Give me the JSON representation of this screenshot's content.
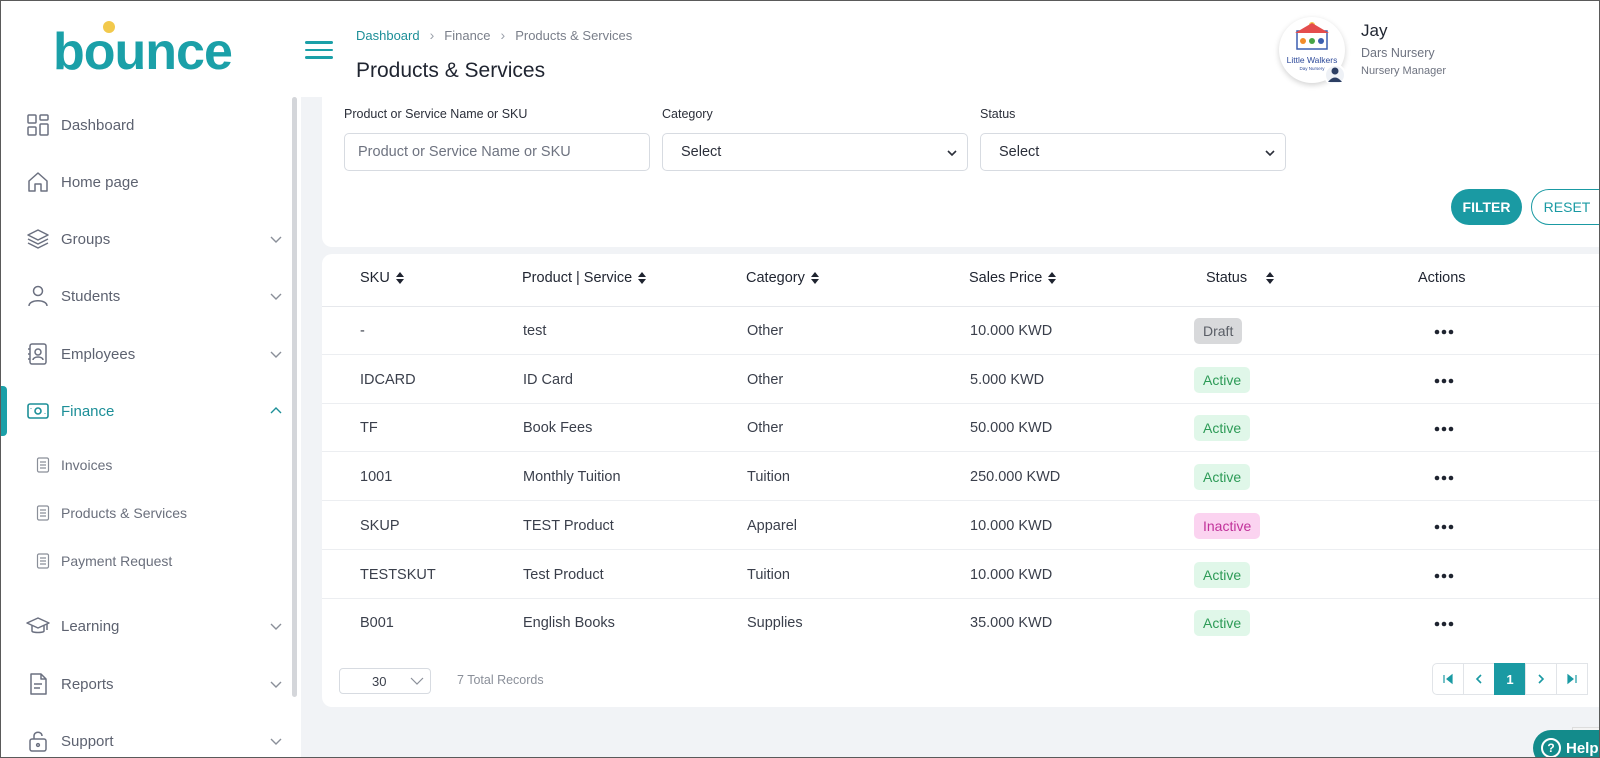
{
  "brand": {
    "logo_text": "bounce",
    "accent": "#1a9aa3"
  },
  "breadcrumb": [
    {
      "label": "Dashboard",
      "link": true
    },
    {
      "label": "Finance",
      "link": false
    },
    {
      "label": "Products & Services",
      "link": false
    }
  ],
  "page_title": "Products & Services",
  "user": {
    "name": "Jay",
    "org": "Dars Nursery",
    "role": "Nursery Manager",
    "avatar_logo_text": "Little Walkers",
    "avatar_logo_sub": "Day Nursery"
  },
  "sidebar": {
    "items": [
      {
        "label": "Dashboard",
        "icon": "dashboard-icon",
        "expandable": false
      },
      {
        "label": "Home page",
        "icon": "home-icon",
        "expandable": false
      },
      {
        "label": "Groups",
        "icon": "layers-icon",
        "expandable": true
      },
      {
        "label": "Students",
        "icon": "user-icon",
        "expandable": true
      },
      {
        "label": "Employees",
        "icon": "id-card-icon",
        "expandable": true
      },
      {
        "label": "Finance",
        "icon": "money-icon",
        "expandable": true,
        "active": true
      },
      {
        "label": "Learning",
        "icon": "graduation-cap-icon",
        "expandable": true
      },
      {
        "label": "Reports",
        "icon": "report-icon",
        "expandable": true
      },
      {
        "label": "Support",
        "icon": "lock-icon",
        "expandable": true
      }
    ],
    "finance_sub": [
      {
        "label": "Invoices",
        "icon": "document-icon"
      },
      {
        "label": "Products & Services",
        "icon": "document-icon"
      },
      {
        "label": "Payment Request",
        "icon": "document-icon"
      }
    ]
  },
  "filters": {
    "name_label": "Product or Service Name or SKU",
    "name_placeholder": "Product or Service Name or SKU",
    "category_label": "Category",
    "category_value": "Select",
    "status_label": "Status",
    "status_value": "Select",
    "filter_button": "FILTER",
    "reset_button": "RESET"
  },
  "table": {
    "columns": [
      "SKU",
      "Product | Service",
      "Category",
      "Sales Price",
      "Status",
      "Actions"
    ],
    "rows": [
      {
        "sku": "-",
        "product": "test",
        "category": "Other",
        "price": "10.000 KWD",
        "status": "Draft"
      },
      {
        "sku": "IDCARD",
        "product": "ID Card",
        "category": "Other",
        "price": "5.000 KWD",
        "status": "Active"
      },
      {
        "sku": "TF",
        "product": "Book Fees",
        "category": "Other",
        "price": "50.000 KWD",
        "status": "Active"
      },
      {
        "sku": "1001",
        "product": "Monthly Tuition",
        "category": "Tuition",
        "price": "250.000 KWD",
        "status": "Active"
      },
      {
        "sku": "SKUP",
        "product": "TEST Product",
        "category": "Apparel",
        "price": "10.000 KWD",
        "status": "Inactive"
      },
      {
        "sku": "TESTSKUT",
        "product": "Test Product",
        "category": "Tuition",
        "price": "10.000 KWD",
        "status": "Active"
      },
      {
        "sku": "B001",
        "product": "English Books",
        "category": "Supplies",
        "price": "35.000 KWD",
        "status": "Active"
      }
    ]
  },
  "pagination": {
    "page_size": "30",
    "total_records": "7 Total Records",
    "current_page": "1"
  },
  "help_button": "Help"
}
